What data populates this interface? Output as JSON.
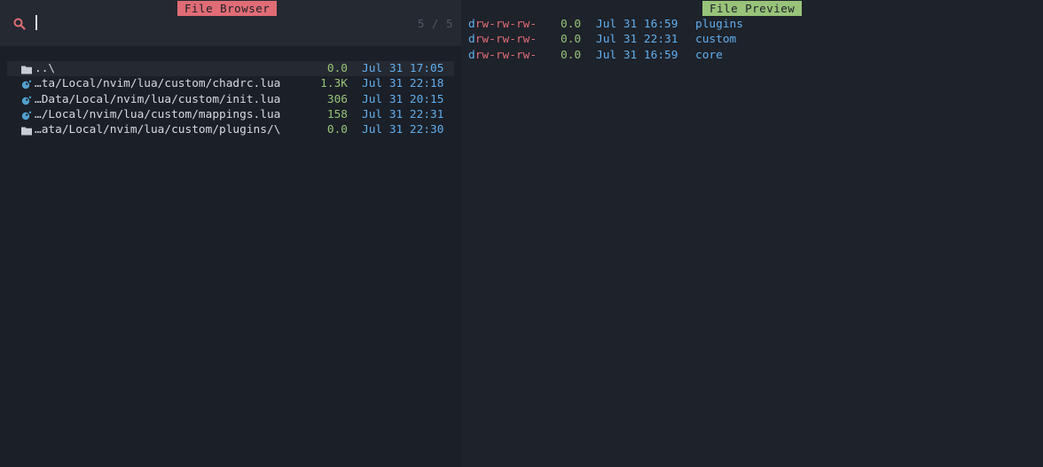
{
  "browser": {
    "title": "File Browser",
    "prompt": {
      "value": "",
      "placeholder": ""
    },
    "counter": "5 / 5",
    "results": [
      {
        "icon": "folder-icon",
        "name": "..\\",
        "size": "0.0",
        "date": "Jul 31 17:05",
        "selected": true
      },
      {
        "icon": "lua-icon",
        "name": "…ta/Local/nvim/lua/custom/chadrc.lua",
        "size": "1.3K",
        "date": "Jul 31 22:18",
        "selected": false
      },
      {
        "icon": "lua-icon",
        "name": "…Data/Local/nvim/lua/custom/init.lua",
        "size": "306",
        "date": "Jul 31 20:15",
        "selected": false
      },
      {
        "icon": "lua-icon",
        "name": "…/Local/nvim/lua/custom/mappings.lua",
        "size": "158",
        "date": "Jul 31 22:31",
        "selected": false
      },
      {
        "icon": "folder-icon",
        "name": "…ata/Local/nvim/lua/custom/plugins/\\",
        "size": "0.0",
        "date": "Jul 31 22:30",
        "selected": false
      }
    ]
  },
  "preview": {
    "title": "File Preview",
    "entries": [
      {
        "perm_d": "d",
        "perm_rest": "rw-rw-rw-",
        "size": "0.0",
        "date": "Jul 31 16:59",
        "name": "plugins"
      },
      {
        "perm_d": "d",
        "perm_rest": "rw-rw-rw-",
        "size": "0.0",
        "date": "Jul 31 22:31",
        "name": "custom"
      },
      {
        "perm_d": "d",
        "perm_rest": "rw-rw-rw-",
        "size": "0.0",
        "date": "Jul 31 16:59",
        "name": "core"
      }
    ]
  },
  "colors": {
    "background": "#1b1f27",
    "prompt_bg": "#252931",
    "preview_bg": "#1e222a",
    "accent_red": "#e06c75",
    "accent_green": "#98c379",
    "accent_blue": "#61afef",
    "muted": "#545862"
  }
}
